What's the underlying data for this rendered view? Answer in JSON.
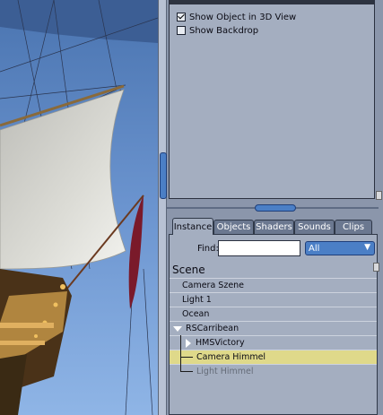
{
  "properties": {
    "show_object_in_3d_view": {
      "label": "Show Object in 3D View",
      "checked": true
    },
    "show_backdrop": {
      "label": "Show Backdrop",
      "checked": false
    }
  },
  "tabs": [
    {
      "label": "Instance",
      "active": true
    },
    {
      "label": "Objects",
      "active": false
    },
    {
      "label": "Shaders",
      "active": false
    },
    {
      "label": "Sounds",
      "active": false
    },
    {
      "label": "Clips",
      "active": false
    }
  ],
  "find": {
    "label": "Find:",
    "value": ""
  },
  "filter": {
    "selected": "All",
    "chevron": "chevron-down-icon"
  },
  "scene": {
    "title": "Scene",
    "items": [
      {
        "label": "Camera Szene",
        "level": 0
      },
      {
        "label": "Light 1",
        "level": 0
      },
      {
        "label": "Ocean",
        "level": 0
      },
      {
        "label": "RSCarribean",
        "level": 0,
        "expanded": true
      },
      {
        "label": "HMSVictory",
        "level": 1,
        "collapsed": true
      },
      {
        "label": "Camera Himmel",
        "level": 1,
        "selected": true
      },
      {
        "label": "Light Himmel",
        "level": 1,
        "dim": true
      }
    ]
  },
  "colors": {
    "accent": "#4b7fc6",
    "selection": "#dfd98a",
    "panel": "#a4aec0",
    "flag": "#7a1a2a",
    "sail": "#d4d4cf"
  }
}
